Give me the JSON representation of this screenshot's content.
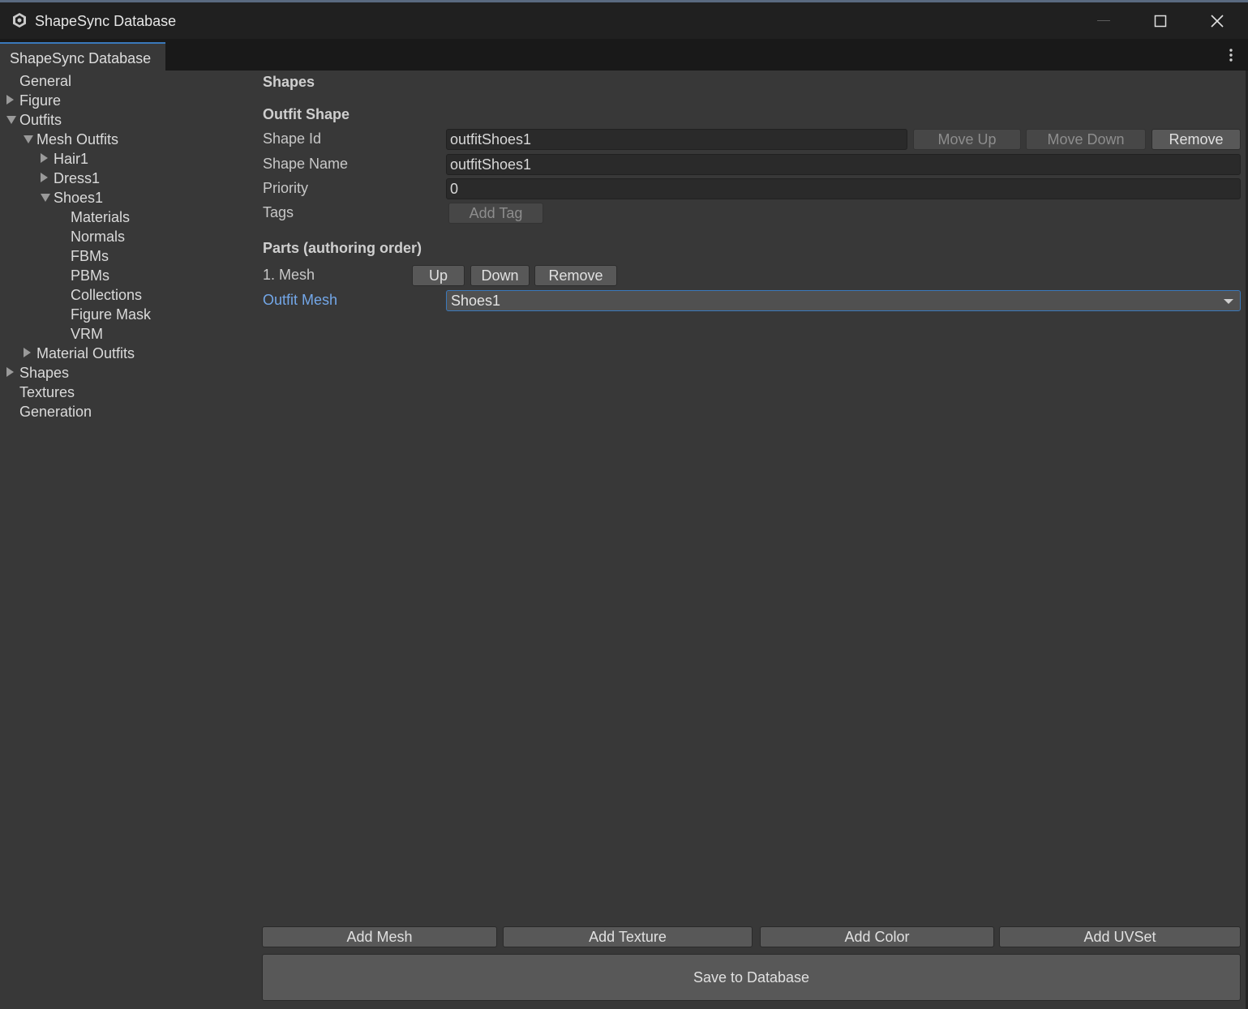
{
  "window": {
    "title": "ShapeSync Database",
    "icon": "unity-cube-icon"
  },
  "tab": {
    "label": "ShapeSync Database"
  },
  "tree": [
    {
      "label": "General",
      "depth": 0,
      "state": "leaf"
    },
    {
      "label": "Figure",
      "depth": 0,
      "state": "collapsed"
    },
    {
      "label": "Outfits",
      "depth": 0,
      "state": "expanded"
    },
    {
      "label": "Mesh Outfits",
      "depth": 1,
      "state": "expanded"
    },
    {
      "label": "Hair1",
      "depth": 2,
      "state": "collapsed"
    },
    {
      "label": "Dress1",
      "depth": 2,
      "state": "collapsed"
    },
    {
      "label": "Shoes1",
      "depth": 2,
      "state": "expanded"
    },
    {
      "label": "Materials",
      "depth": 3,
      "state": "leaf"
    },
    {
      "label": "Normals",
      "depth": 3,
      "state": "leaf"
    },
    {
      "label": "FBMs",
      "depth": 3,
      "state": "leaf"
    },
    {
      "label": "PBMs",
      "depth": 3,
      "state": "leaf"
    },
    {
      "label": "Collections",
      "depth": 3,
      "state": "leaf"
    },
    {
      "label": "Figure Mask",
      "depth": 3,
      "state": "leaf"
    },
    {
      "label": "VRM",
      "depth": 3,
      "state": "leaf"
    },
    {
      "label": "Material Outfits",
      "depth": 1,
      "state": "collapsed"
    },
    {
      "label": "Shapes",
      "depth": 0,
      "state": "collapsed"
    },
    {
      "label": "Textures",
      "depth": 0,
      "state": "leaf"
    },
    {
      "label": "Generation",
      "depth": 0,
      "state": "leaf"
    }
  ],
  "main": {
    "section_title": "Shapes",
    "outfit_shape": {
      "heading": "Outfit Shape",
      "shape_id_label": "Shape Id",
      "shape_id_value": "outfitShoes1",
      "move_up_label": "Move Up",
      "move_down_label": "Move Down",
      "remove_label": "Remove",
      "shape_name_label": "Shape Name",
      "shape_name_value": "outfitShoes1",
      "priority_label": "Priority",
      "priority_value": "0",
      "tags_label": "Tags",
      "add_tag_label": "Add Tag"
    },
    "parts": {
      "heading": "Parts (authoring order)",
      "item_label": "1. Mesh",
      "up_label": "Up",
      "down_label": "Down",
      "remove_label": "Remove",
      "outfit_mesh_label": "Outfit Mesh",
      "outfit_mesh_value": "Shoes1"
    },
    "bottom": {
      "add_mesh": "Add Mesh",
      "add_texture": "Add Texture",
      "add_color": "Add Color",
      "add_uvset": "Add UVSet",
      "save": "Save to Database"
    }
  },
  "colors": {
    "accent": "#3a79bb",
    "link_label": "#73a7e8",
    "background": "#383838"
  }
}
